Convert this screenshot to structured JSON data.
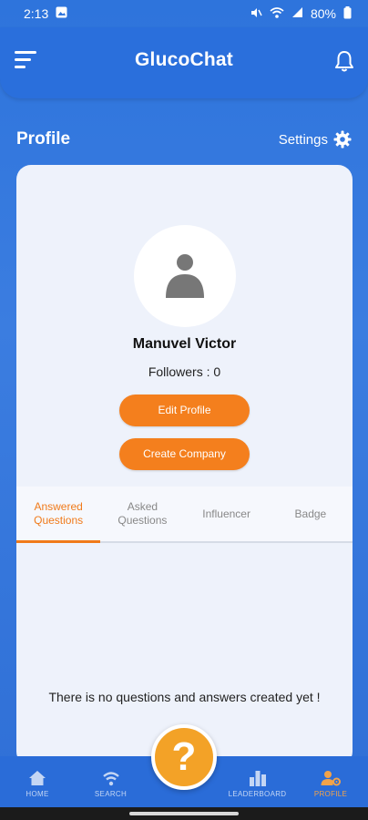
{
  "status_bar": {
    "time": "2:13",
    "battery": "80%"
  },
  "header": {
    "app_title": "GlucoChat"
  },
  "profile": {
    "heading": "Profile",
    "settings_label": "Settings",
    "name": "Manuvel Victor",
    "followers": "Followers : 0",
    "edit_profile_label": "Edit Profile",
    "create_company_label": "Create Company"
  },
  "tabs": [
    {
      "label": "Answered Questions",
      "active": true
    },
    {
      "label": "Asked Questions",
      "active": false
    },
    {
      "label": "Influencer",
      "active": false
    },
    {
      "label": "Badge",
      "active": false
    }
  ],
  "empty_message": "There is no questions and answers created yet !",
  "bottom_nav": {
    "home": "HOME",
    "search": "SEARCH",
    "ask_icon_label": "?",
    "leaderboard": "LEADERBOARD",
    "profile": "PROFILE"
  },
  "colors": {
    "primary_blue": "#2a6fdc",
    "accent_orange": "#f47f1d",
    "card_bg": "#eef2fb",
    "fab": "#f3a227"
  }
}
